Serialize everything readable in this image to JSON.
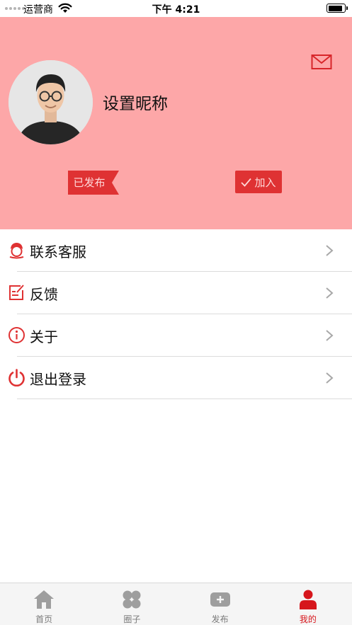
{
  "status_bar": {
    "carrier": "运营商",
    "time": "下午 4:21",
    "battery_level": 0.9
  },
  "profile": {
    "nickname": "设置昵称",
    "published_tag": "已发布",
    "join_button": "加入"
  },
  "menu": [
    {
      "label": "联系客服",
      "icon": "customer-service-icon"
    },
    {
      "label": "反馈",
      "icon": "feedback-icon"
    },
    {
      "label": "关于",
      "icon": "info-icon"
    },
    {
      "label": "退出登录",
      "icon": "power-icon"
    }
  ],
  "tabs": [
    {
      "label": "首页",
      "icon": "home-icon",
      "active": false
    },
    {
      "label": "圈子",
      "icon": "circles-icon",
      "active": false
    },
    {
      "label": "发布",
      "icon": "publish-icon",
      "active": false
    },
    {
      "label": "我的",
      "icon": "profile-icon",
      "active": true
    }
  ],
  "colors": {
    "header_bg": "#fda7a8",
    "accent_red": "#df3233",
    "tab_active": "#d6161c",
    "tab_inactive": "#7a7a7a"
  }
}
